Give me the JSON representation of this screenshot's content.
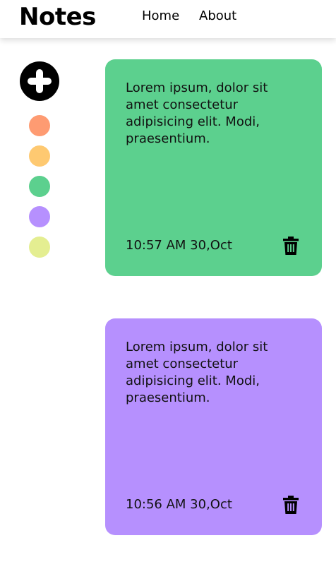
{
  "navbar": {
    "brand": "Notes",
    "links": [
      "Home",
      "About"
    ]
  },
  "sidebar": {
    "add_icon": "plus-circle-icon",
    "colors": [
      "#fe9b72",
      "#fec971",
      "#5cd08e",
      "#b690fe",
      "#e4ee91"
    ]
  },
  "notes": [
    {
      "text": "Lorem ipsum, dolor sit amet consectetur adipisicing elit. Modi, praesentium.",
      "time": "10:57 AM 30,Oct",
      "color": "#5cd08e",
      "delete_icon": "trash-icon"
    },
    {
      "text": "Lorem ipsum, dolor sit amet consectetur adipisicing elit. Modi, praesentium.",
      "time": "10:56 AM 30,Oct",
      "color": "#b690fe",
      "delete_icon": "trash-icon"
    }
  ]
}
